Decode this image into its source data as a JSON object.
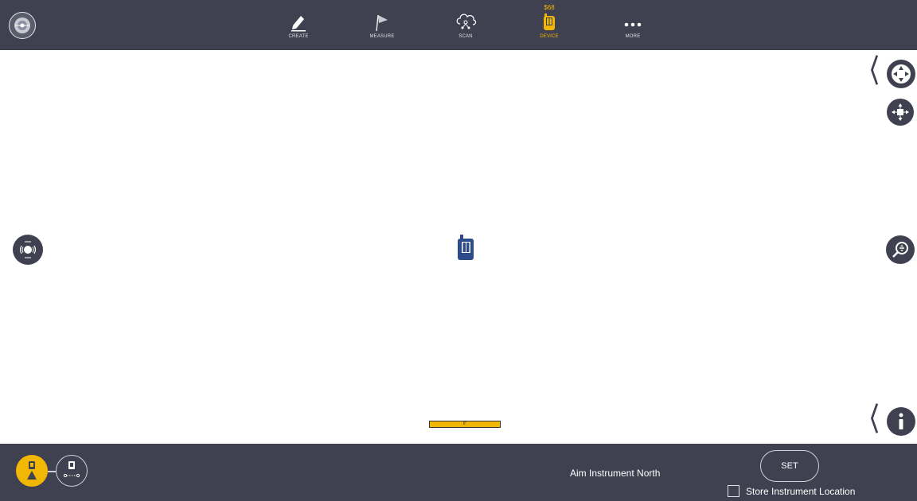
{
  "toolbar": {
    "items": [
      {
        "label": "CREATE",
        "icon": "pencil-icon"
      },
      {
        "label": "MEASURE",
        "icon": "flag-icon"
      },
      {
        "label": "SCAN",
        "icon": "cloud-scan-icon"
      },
      {
        "label": "DEVICE",
        "icon": "laser-device-icon",
        "badge": "$68",
        "active": true
      },
      {
        "label": "MORE",
        "icon": "more-dots-icon"
      }
    ]
  },
  "canvas": {
    "scale_label": "6\""
  },
  "bottom": {
    "instruction": "Aim Instrument North",
    "set_label": "SET",
    "store_label": "Store Instrument Location",
    "store_checked": false
  },
  "colors": {
    "bar": "#3f4150",
    "accent": "#f2b705",
    "device_blue": "#2d4a8a"
  }
}
